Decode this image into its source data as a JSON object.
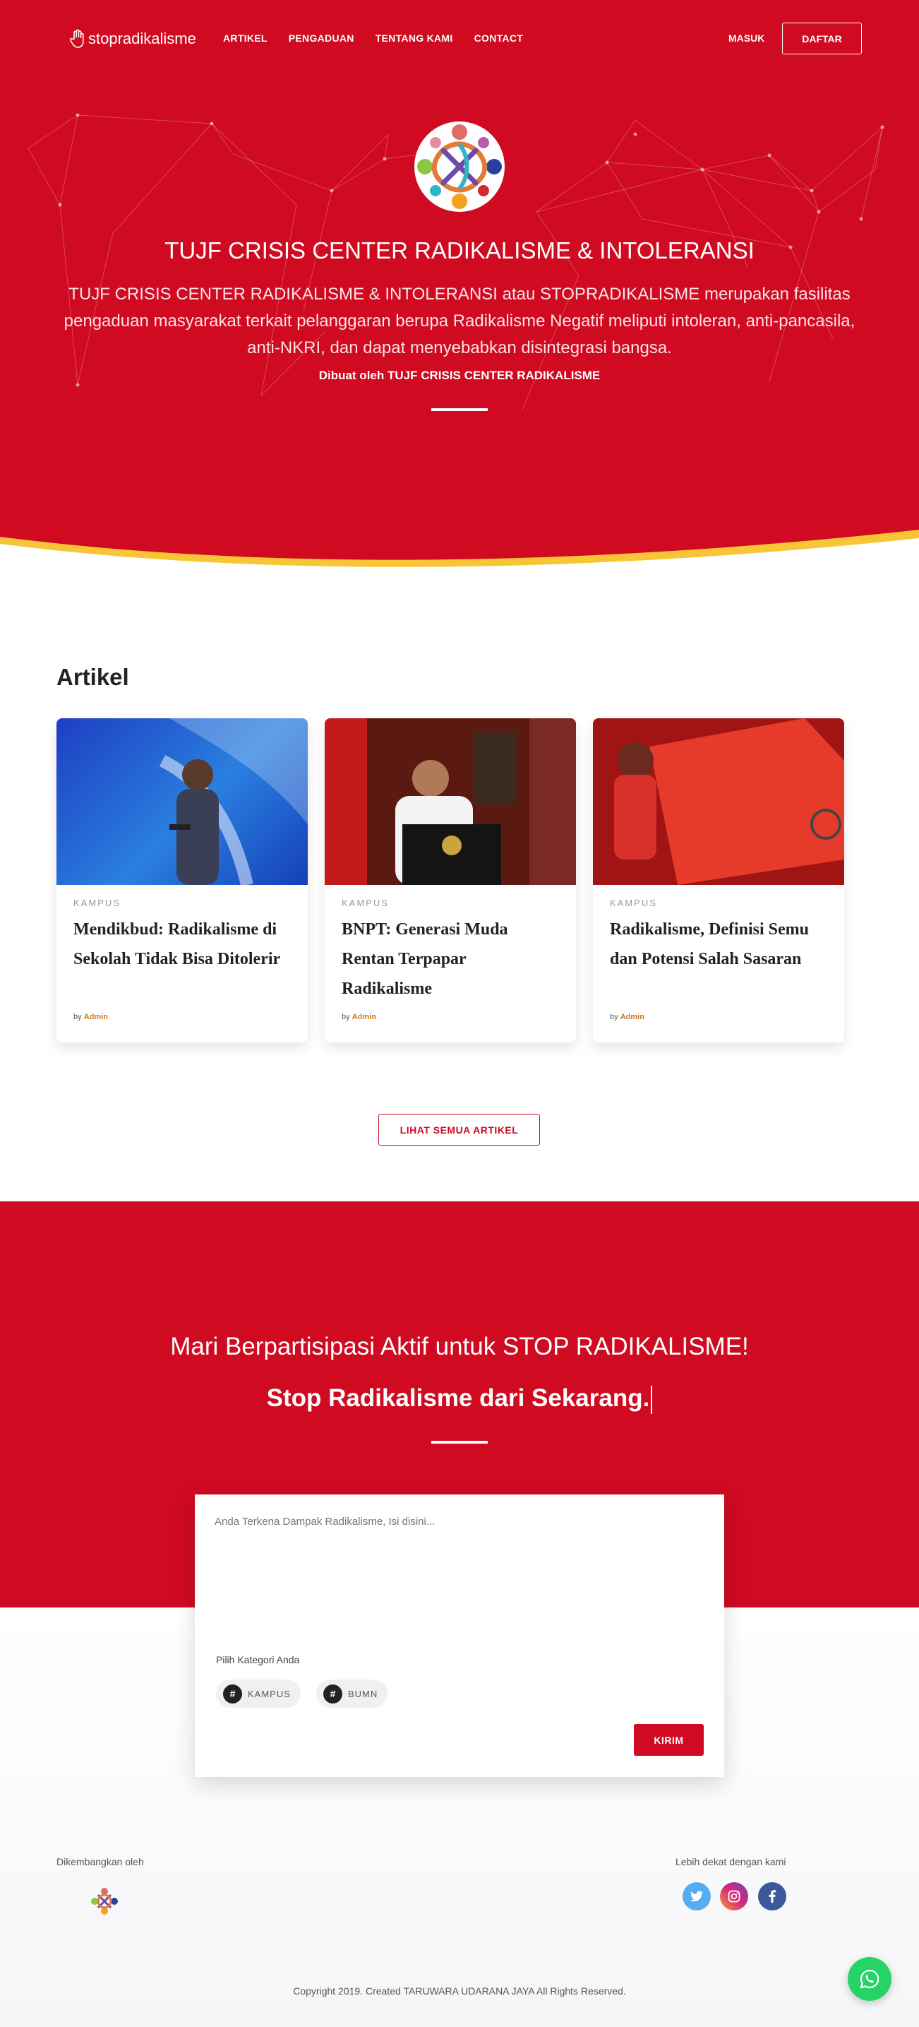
{
  "brand": {
    "name": "stopradikalisme"
  },
  "nav": {
    "links": [
      "ARTIKEL",
      "PENGADUAN",
      "TENTANG KAMI",
      "CONTACT"
    ],
    "login": "MASUK",
    "register": "DAFTAR"
  },
  "hero": {
    "title": "TUJF CRISIS CENTER RADIKALISME & INTOLERANSI",
    "description": "TUJF CRISIS CENTER RADIKALISME & INTOLERANSI atau STOPRADIKALISME merupakan fasilitas pengaduan masyarakat terkait pelanggaran berupa Radikalisme Negatif meliputi intoleran, anti-pancasila, anti-NKRI, dan dapat menyebabkan disintegrasi bangsa.",
    "byline": "Dibuat oleh TUJF CRISIS CENTER RADIKALISME"
  },
  "articles": {
    "heading": "Artikel",
    "items": [
      {
        "category": "KAMPUS",
        "title": "Mendikbud: Radikalisme di Sekolah Tidak Bisa Ditolerir",
        "by": "by",
        "author": "Admin"
      },
      {
        "category": "KAMPUS",
        "title": "BNPT: Generasi Muda Rentan Terpapar Radikalisme",
        "by": "by",
        "author": "Admin"
      },
      {
        "category": "KAMPUS",
        "title": "Radikalisme, Definisi Semu dan Potensi Salah Sasaran",
        "by": "by",
        "author": "Admin"
      }
    ],
    "see_all": "LIHAT SEMUA ARTIKEL"
  },
  "cta": {
    "line1": "Mari Berpartisipasi Aktif untuk STOP RADIKALISME!",
    "line2": "Stop Radikalisme dari Sekarang."
  },
  "form": {
    "placeholder": "Anda Terkena Dampak Radikalisme, Isi disini...",
    "category_label": "Pilih Kategori Anda",
    "categories": [
      "KAMPUS",
      "BUMN"
    ],
    "submit": "KIRIM"
  },
  "footer": {
    "developed_by": "Dikembangkan oleh",
    "social_label": "Lebih dekat dengan kami",
    "social": [
      {
        "name": "twitter",
        "icon": "twitter-icon",
        "color": "#55acee"
      },
      {
        "name": "instagram",
        "icon": "instagram-icon",
        "color": "#c13584"
      },
      {
        "name": "facebook",
        "icon": "facebook-icon",
        "color": "#3b5998"
      }
    ],
    "copyright": "Copyright 2019. Created TARUWARA UDARANA JAYA All Rights Reserved."
  },
  "colors": {
    "primary": "#cf0a21",
    "accent": "#f7c536",
    "whatsapp": "#25d366"
  }
}
